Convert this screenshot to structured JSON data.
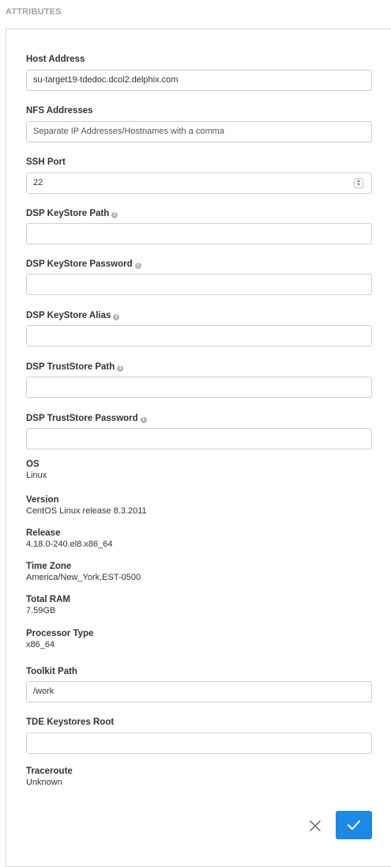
{
  "section": {
    "header": "ATTRIBUTES"
  },
  "fields": {
    "host_address": {
      "label": "Host Address",
      "value": "su-target19-tdedoc.dcol2.delphix.com"
    },
    "nfs_addresses": {
      "label": "NFS Addresses",
      "placeholder": "Separate IP Addresses/Hostnames with a comma"
    },
    "ssh_port": {
      "label": "SSH Port",
      "value": "22"
    },
    "dsp_keystore_path": {
      "label": "DSP KeyStore Path",
      "value": ""
    },
    "dsp_keystore_password": {
      "label": "DSP KeyStore Password",
      "value": ""
    },
    "dsp_keystore_alias": {
      "label": "DSP KeyStore Alias",
      "value": ""
    },
    "dsp_truststore_path": {
      "label": "DSP TrustStore Path",
      "value": ""
    },
    "dsp_truststore_password": {
      "label": "DSP TrustStore Password",
      "value": ""
    },
    "toolkit_path": {
      "label": "Toolkit Path",
      "value": "/work"
    },
    "tde_keystores_root": {
      "label": "TDE Keystores Root",
      "value": ""
    }
  },
  "info": {
    "os": {
      "label": "OS",
      "value": "Linux"
    },
    "version": {
      "label": "Version",
      "value": "CentOS Linux release 8.3.2011"
    },
    "release": {
      "label": "Release",
      "value": "4.18.0-240.el8.x86_64"
    },
    "time_zone": {
      "label": "Time Zone",
      "value": "America/New_York,EST-0500"
    },
    "total_ram": {
      "label": "Total RAM",
      "value": "7.59GB"
    },
    "processor_type": {
      "label": "Processor Type",
      "value": "x86_64"
    },
    "traceroute": {
      "label": "Traceroute",
      "value": "Unknown"
    }
  },
  "info_icon_glyph": "i",
  "actions": {
    "cancel_icon": "close-icon",
    "confirm_icon": "checkmark-icon",
    "confirm_color": "#1e88e5"
  }
}
